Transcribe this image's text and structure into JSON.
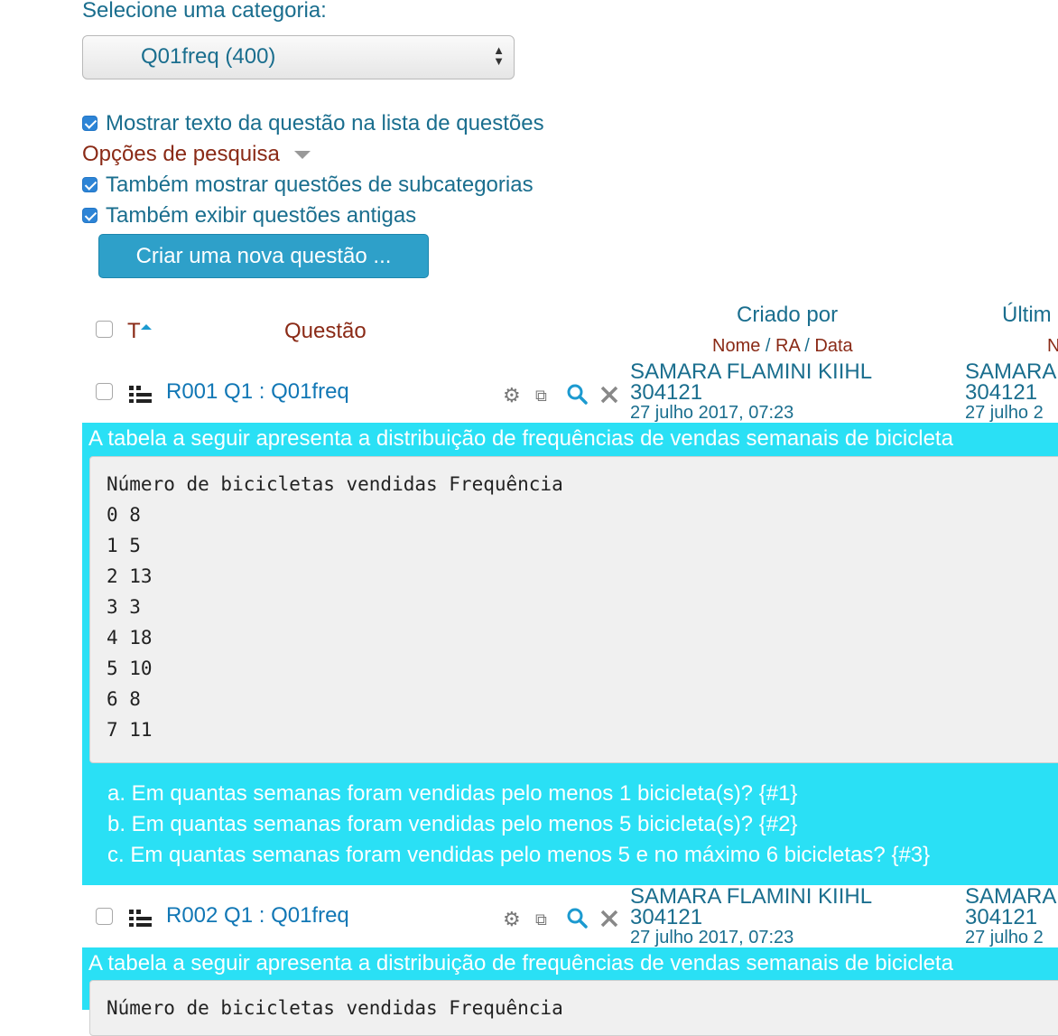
{
  "category": {
    "label": "Selecione uma categoria:",
    "selected": "Q01freq (400)"
  },
  "options": {
    "show_text": "Mostrar texto da questão na lista de questões",
    "search_options": "Opções de pesquisa",
    "show_subcategories": "Também mostrar questões de subcategorias",
    "show_old": "Também exibir questões antigas"
  },
  "create_button": "Criar uma nova questão ...",
  "table_header": {
    "type": "T",
    "question": "Questão",
    "created_by": "Criado por",
    "created_sub": {
      "name": "Nome",
      "sep1": " / ",
      "ra": "RA",
      "sep2": " / ",
      "date": "Data"
    },
    "last_modified": "Últim",
    "last_sub": "N"
  },
  "questions": [
    {
      "title": "R001 Q1 : Q01freq",
      "creator_name": "SAMARA FLAMINI KIIHL",
      "creator_ra": "304121",
      "creator_date": "27 julho 2017, 07:23",
      "mod_name": "SAMARA",
      "mod_ra": "304121",
      "mod_date": "27 julho 2",
      "lead": "A tabela a seguir apresenta a distribuição de frequências de vendas semanais de bicicleta",
      "table_lines": [
        "Número de bicicletas vendidas Frequência",
        "0 8",
        "1 5",
        "2 13",
        "3 3",
        "4 18",
        "5 10",
        "6 8",
        "7 11"
      ],
      "subquestions": [
        "a.  Em quantas semanas foram vendidas pelo menos 1 bicicleta(s)? {#1}",
        "b.  Em quantas semanas foram vendidas pelo menos 5 bicicleta(s)? {#2}",
        "c.  Em quantas semanas foram vendidas pelo menos 5 e no máximo 6 bicicletas? {#3}"
      ]
    },
    {
      "title": "R002 Q1 : Q01freq",
      "creator_name": "SAMARA FLAMINI KIIHL",
      "creator_ra": "304121",
      "creator_date": "27 julho 2017, 07:23",
      "mod_name": "SAMARA",
      "mod_ra": "304121",
      "mod_date": "27 julho 2",
      "lead": "A tabela a seguir apresenta a distribuição de frequências de vendas semanais de bicicleta",
      "table_first_line": "Número de bicicletas vendidas Frequência"
    }
  ],
  "icons": {
    "gear": "gear-icon",
    "copy": "copy-icon",
    "preview": "search-icon",
    "delete": "close-icon",
    "question_type": "calculated-question-icon",
    "dropdown": "caret-down-icon",
    "sort": "sort-up-icon"
  },
  "colors": {
    "link": "#1a6e8e",
    "header_brown": "#8a2a16",
    "question_band": "#2ae0f5",
    "button": "#2ea0c9",
    "checkbox": "#2d84d6"
  }
}
